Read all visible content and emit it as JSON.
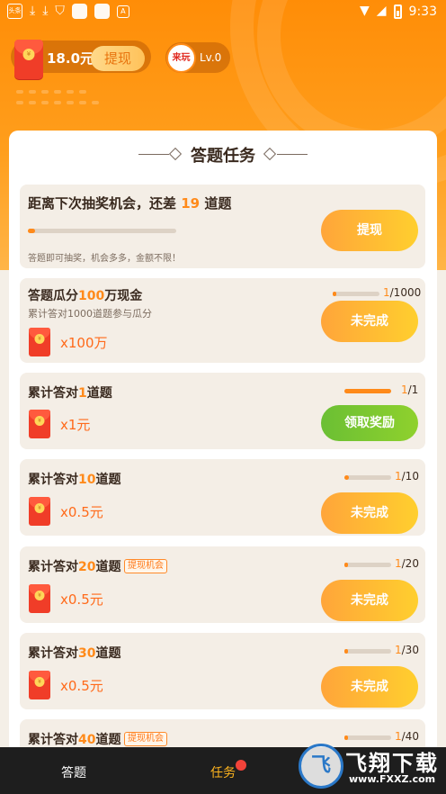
{
  "status_bar": {
    "app_box": "头条",
    "box_letter": "A",
    "time": "9:33"
  },
  "wallet": {
    "amount": "18.0元",
    "withdraw_label": "提现",
    "level_logo": "来玩",
    "level": "Lv.0"
  },
  "panel": {
    "title": "答题任务"
  },
  "lottery": {
    "title_prefix": "距离下次抽奖机会，还差 ",
    "title_count": "19",
    "title_suffix": " 道题",
    "progress": 0.03,
    "note": "答题即可抽奖，机会多多，金额不限！",
    "button": "提现"
  },
  "tasks": [
    {
      "title_prefix": "答题瓜分",
      "title_hl": "100",
      "title_suffix": "万现金",
      "sub": "累计答对1000道题参与瓜分",
      "reward": "x100万",
      "current": "1",
      "total": "/1000",
      "progress": 0.001,
      "button": "未完成",
      "state": "incomplete"
    },
    {
      "title_prefix": "累计答对",
      "title_hl": "1",
      "title_suffix": "道题",
      "reward": "x1元",
      "current": "1",
      "total": "/1",
      "progress": 1.0,
      "button": "领取奖励",
      "state": "claim"
    },
    {
      "title_prefix": "累计答对",
      "title_hl": "10",
      "title_suffix": "道题",
      "reward": "x0.5元",
      "current": "1",
      "total": "/10",
      "progress": 0.1,
      "button": "未完成",
      "state": "incomplete"
    },
    {
      "title_prefix": "累计答对",
      "title_hl": "20",
      "title_suffix": "道题",
      "badge": "提现机会",
      "reward": "x0.5元",
      "current": "1",
      "total": "/20",
      "progress": 0.05,
      "button": "未完成",
      "state": "incomplete"
    },
    {
      "title_prefix": "累计答对",
      "title_hl": "30",
      "title_suffix": "道题",
      "reward": "x0.5元",
      "current": "1",
      "total": "/30",
      "progress": 0.033,
      "button": "未完成",
      "state": "incomplete"
    },
    {
      "title_prefix": "累计答对",
      "title_hl": "40",
      "title_suffix": "道题",
      "badge": "提现机会",
      "current": "1",
      "total": "/40",
      "progress": 0.025
    }
  ],
  "bottom_nav": {
    "items": [
      {
        "label": "答题"
      },
      {
        "label": "任务",
        "active": true
      }
    ]
  },
  "watermark": {
    "logo": "飞",
    "title": "飞翔下载",
    "url": "www.FXXZ.com"
  },
  "colors": {
    "header_orange": "#ff8d07",
    "accent": "#ff8a1a",
    "card_bg": "#f4eee6",
    "claim_green": "#6bbf34",
    "nav_bg": "#1e1e1e"
  }
}
